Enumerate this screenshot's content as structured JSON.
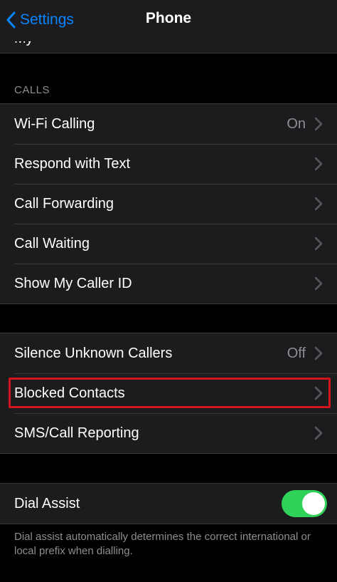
{
  "nav": {
    "back_label": "Settings",
    "title": "Phone"
  },
  "calls_section": {
    "header": "CALLS",
    "rows": [
      {
        "label": "Wi-Fi Calling",
        "value": "On"
      },
      {
        "label": "Respond with Text",
        "value": ""
      },
      {
        "label": "Call Forwarding",
        "value": ""
      },
      {
        "label": "Call Waiting",
        "value": ""
      },
      {
        "label": "Show My Caller ID",
        "value": ""
      }
    ]
  },
  "block_section": {
    "rows": [
      {
        "label": "Silence Unknown Callers",
        "value": "Off"
      },
      {
        "label": "Blocked Contacts",
        "value": ""
      },
      {
        "label": "SMS/Call Reporting",
        "value": ""
      }
    ]
  },
  "dial_assist": {
    "label": "Dial Assist",
    "enabled": true,
    "footer": "Dial assist automatically determines the correct international or local prefix when dialling."
  },
  "colors": {
    "accent": "#0a84ff",
    "toggle_on": "#30d158",
    "highlight": "#d2141c"
  }
}
